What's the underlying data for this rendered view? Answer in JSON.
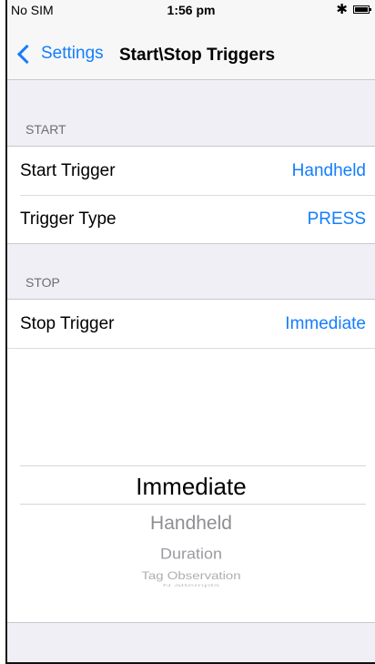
{
  "status_bar": {
    "carrier": "No SIM",
    "time": "1:56 pm",
    "bluetooth_glyph": "✱",
    "icons": [
      "bluetooth-icon",
      "battery-icon"
    ]
  },
  "nav": {
    "back_label": "Settings",
    "title": "Start\\Stop Triggers"
  },
  "sections": [
    {
      "header": "START",
      "rows": [
        {
          "label": "Start Trigger",
          "value": "Handheld"
        },
        {
          "label": "Trigger Type",
          "value": "PRESS"
        }
      ]
    },
    {
      "header": "STOP",
      "rows": [
        {
          "label": "Stop Trigger",
          "value": "Immediate"
        }
      ]
    }
  ],
  "picker": {
    "selected": "Immediate",
    "options": [
      "Immediate",
      "Handheld",
      "Duration",
      "Tag Observation",
      "N attempts"
    ]
  },
  "colors": {
    "accent": "#157efb",
    "background": "#f0eff5",
    "section_header": "#6d6d72"
  }
}
